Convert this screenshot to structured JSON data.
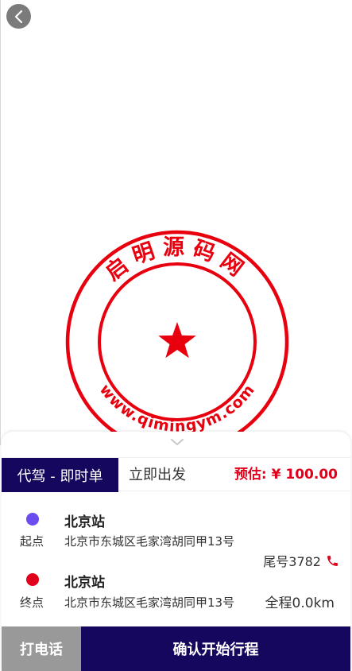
{
  "map": {
    "stamp": {
      "top_text": "启明源码网",
      "bottom_text": "www.qimingym.com",
      "color": "#e8000f"
    }
  },
  "colors": {
    "primary": "#15065e",
    "accent_red": "#e0001b",
    "start_dot": "#6a4cf0",
    "end_dot": "#e0001b"
  },
  "order": {
    "service_type": "代驾 - 即时单",
    "depart_mode": "立即出发",
    "estimate": "预估: ¥ 100.00"
  },
  "route": {
    "start": {
      "role": "起点",
      "name": "北京站",
      "address": "北京市东城区毛家湾胡同甲13号"
    },
    "end": {
      "role": "终点",
      "name": "北京站",
      "address": "北京市东城区毛家湾胡同甲13号"
    },
    "plate_tail": "尾号3782",
    "distance": "全程0.0km"
  },
  "actions": {
    "call": "打电话",
    "confirm": "确认开始行程"
  }
}
